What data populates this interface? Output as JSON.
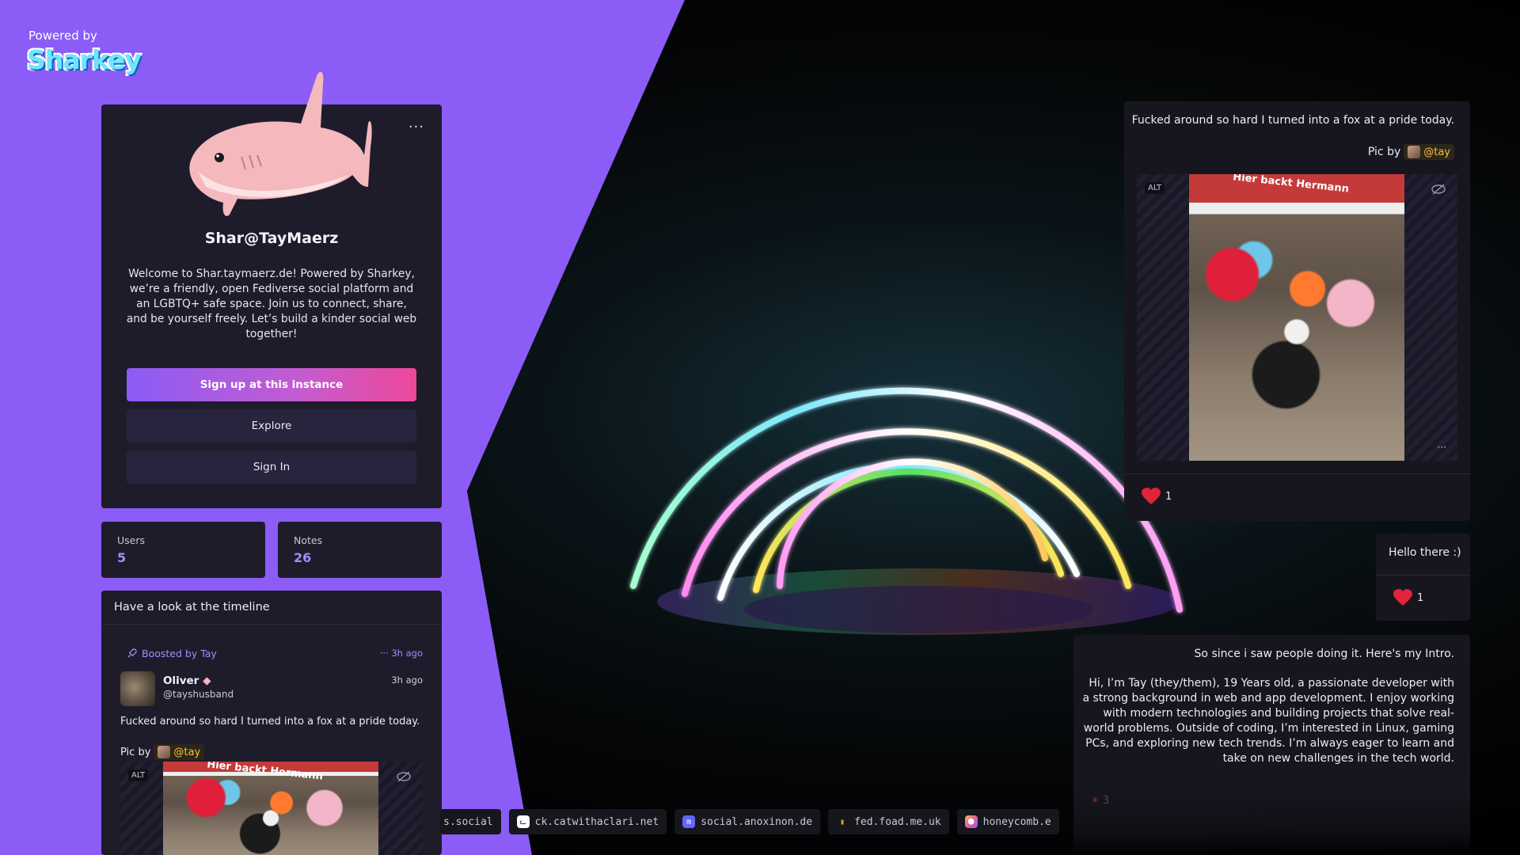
{
  "branding": {
    "powered_by": "Powered by",
    "logo_text": "Sharkey"
  },
  "instance": {
    "name": "Shar@TayMaerz",
    "description": "Welcome to Shar.taymaerz.de! Powered by Sharkey, we’re a friendly, open Fediverse social platform and an LGBTQ+ safe space. Join us to connect, share, and be yourself freely. Let’s build a kinder social web together!",
    "more_label": "···",
    "signup_label": "Sign up at this instance",
    "explore_label": "Explore",
    "signin_label": "Sign In"
  },
  "stats": {
    "users_label": "Users",
    "users_value": "5",
    "notes_label": "Notes",
    "notes_value": "26"
  },
  "timeline": {
    "header": "Have a look at the timeline",
    "boosted_by": "Boosted by Tay",
    "boost_time": "··· 3h ago",
    "user_name": "Oliver",
    "user_handle": "@tayshusband",
    "post_time": "3h ago",
    "post_text": "Fucked around so hard I turned into a fox at a pride today.",
    "pic_by": "Pic by",
    "mention": "@tay",
    "alt": "ALT",
    "photo_sign": "Hier backt Hermann"
  },
  "right_notes": {
    "note1_text": "Fucked around so hard I turned into a fox at a pride today.",
    "note1_picby": "Pic by",
    "note1_mention": "@tay",
    "note1_alt": "ALT",
    "note1_more": "···",
    "note1_reaction_count": "1",
    "note2_text": "Hello there :)",
    "note2_reaction_count": "1",
    "note3_title": "So since i saw people doing it. Here's my Intro.",
    "note3_body": "Hi, I’m Tay (they/them), 19 Years old, a passionate developer with a strong background in web and app development. I enjoy working with modern technologies and building projects that solve real-world problems. Outside of coding, I’m interested in Linux, gaming PCs, and exploring new tech trends. I’m always eager to learn and take on new challenges in the tech world.",
    "note3_reaction_count": "3"
  },
  "federation": [
    {
      "label": "s.social",
      "icon": "globe-icon",
      "color": "#16161d"
    },
    {
      "label": "ck.catwithaclari.net",
      "icon": "cat-icon",
      "color": "#ffffff"
    },
    {
      "label": "social.anoxinon.de",
      "icon": "mastodon-icon",
      "color": "#6364ff"
    },
    {
      "label": "fed.foad.me.uk",
      "icon": "server-icon",
      "color": "#e0a020"
    },
    {
      "label": "honeycomb.e",
      "icon": "honeycomb-icon",
      "color": "#e85d9a"
    }
  ],
  "colors": {
    "accent": "#8b5cf6",
    "accent_text": "#a78bfa",
    "mention": "#f5c14b",
    "heart": "#e0243a"
  }
}
